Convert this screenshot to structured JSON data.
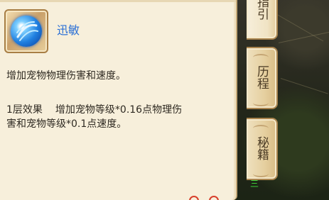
{
  "skill": {
    "name": "迅敏",
    "icon": "swirl-orb-icon",
    "description": "增加宠物物理伤害和速度。",
    "effect_label": "1层效果",
    "effect_text_line1": "增加宠物等级*0.16点物理伤",
    "effect_text_line2": "害和宠物等级*0.1点速度。"
  },
  "tabs": [
    {
      "label": "指引"
    },
    {
      "label": "历程"
    },
    {
      "label": "秘籍"
    }
  ],
  "scene": {
    "green_text": "三"
  },
  "colors": {
    "panel_bg": "#f7efdb",
    "skill_name": "#2a6fd6",
    "body_text": "#2f2a22",
    "tab_border": "#a9844e"
  }
}
